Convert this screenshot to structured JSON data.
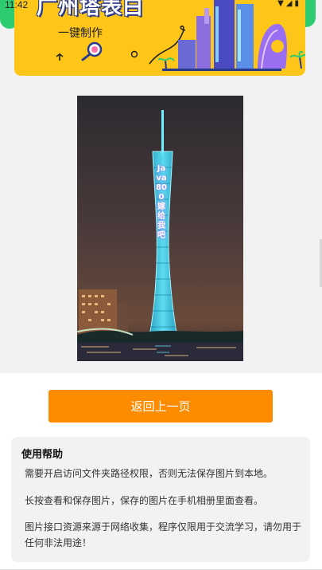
{
  "status_bar": {
    "time": "11:42",
    "icons": [
      "wifi-icon",
      "signal-icon",
      "battery-icon"
    ]
  },
  "banner": {
    "title": "广州塔表白",
    "subtitle": "一键制作"
  },
  "main_image": {
    "caption": "Java800 嫁给我吧"
  },
  "back_button": {
    "label": "返回上一页"
  },
  "help": {
    "title": "使用帮助",
    "items": [
      "需要开启访问文件夹路径权限，否则无法保存图片到本地。",
      "长按查看和保存图片，保存的图片在手机相册里面查看。",
      "图片接口资源来源于网络收集，程序仅限用于交流学习，请勿用于任何非法用途！"
    ]
  },
  "colors": {
    "banner_yellow": "#ffc61a",
    "button_orange": "#ff8c00",
    "page_gray": "#f2f2f2",
    "green_accent": "#2ecc71"
  }
}
